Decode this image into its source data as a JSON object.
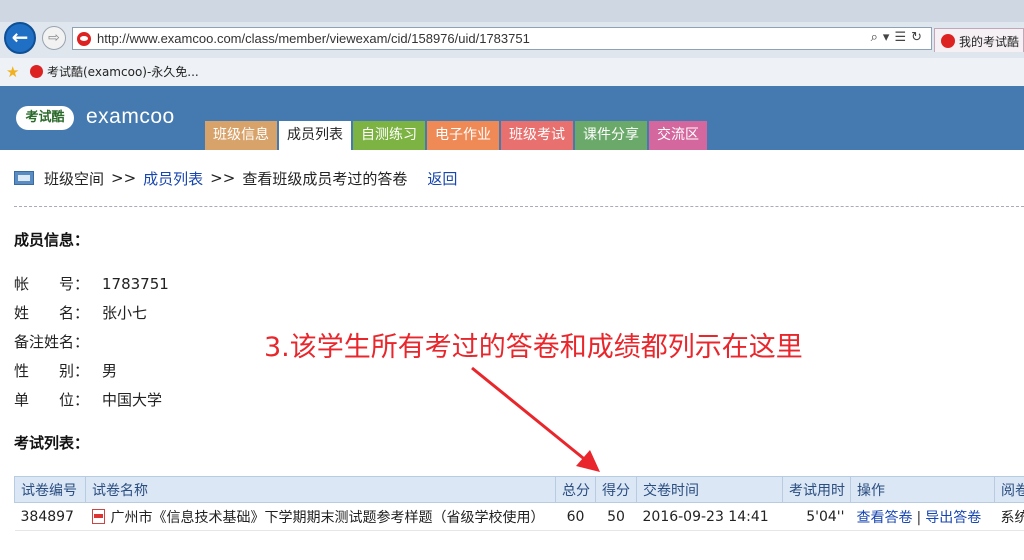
{
  "browser": {
    "url": "http://www.examcoo.com/class/member/viewexam/cid/158976/uid/1783751",
    "tab_label": "我的考试酷",
    "favorite_label": "考试酷(examcoo)-永久免..."
  },
  "site": {
    "logo_badge": "考试酷",
    "logo_text": "examcoo",
    "menu": [
      {
        "label": "班级信息",
        "color": "#d8a36a",
        "active": false
      },
      {
        "label": "成员列表",
        "color": "#ffffff",
        "active": true
      },
      {
        "label": "自测练习",
        "color": "#7cb342",
        "active": false
      },
      {
        "label": "电子作业",
        "color": "#ef8a56",
        "active": false
      },
      {
        "label": "班级考试",
        "color": "#e8706e",
        "active": false
      },
      {
        "label": "课件分享",
        "color": "#6aa96a",
        "active": false
      },
      {
        "label": "交流区",
        "color": "#d4679e",
        "active": false
      }
    ]
  },
  "breadcrumb": {
    "home": "班级空间",
    "sep": ">>",
    "members": "成员列表",
    "current": "查看班级成员考过的答卷",
    "back": "返回"
  },
  "member": {
    "section_title": "成员信息：",
    "rows": [
      {
        "label": "帐　　号：",
        "value": "1783751"
      },
      {
        "label": "姓　　名：",
        "value": "张小七"
      },
      {
        "label": "备注姓名：",
        "value": ""
      },
      {
        "label": "性　　别：",
        "value": "男"
      },
      {
        "label": "单　　位：",
        "value": "中国大学"
      }
    ]
  },
  "annotation": "3.该学生所有考过的答卷和成绩都列示在这里",
  "exams": {
    "section_title": "考试列表：",
    "headers": [
      "试卷编号",
      "试卷名称",
      "总分",
      "得分",
      "交卷时间",
      "考试用时",
      "操作",
      "阅卷"
    ],
    "rows": [
      {
        "id": "384897",
        "name": "广州市《信息技术基础》下学期期末测试题参考样题（省级学校使用）",
        "total": "60",
        "score": "50",
        "submitted": "2016-09-23 14:41",
        "duration": "5'04''",
        "action_view": "查看答卷",
        "action_sep": "|",
        "action_export": "导出答卷",
        "grader": "系统"
      }
    ]
  }
}
